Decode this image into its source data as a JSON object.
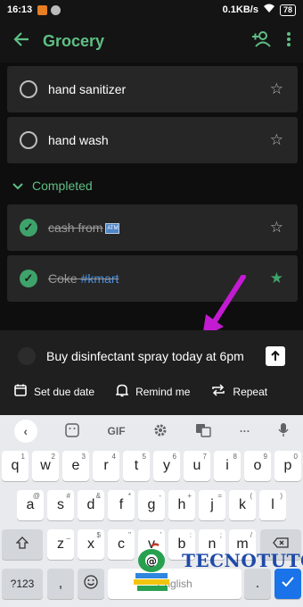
{
  "status_bar": {
    "time": "16:13",
    "speed": "0.1KB/s",
    "battery": "78"
  },
  "app_bar": {
    "title": "Grocery",
    "back_icon": "arrow-left",
    "share_icon": "person-add",
    "menu_icon": "more-vertical"
  },
  "tasks": [
    {
      "text": "hand sanitizer",
      "completed": false,
      "starred": false
    },
    {
      "text": "hand wash",
      "completed": false,
      "starred": false
    }
  ],
  "completed_section": {
    "label": "Completed",
    "items": [
      {
        "text": "cash from",
        "completed": true,
        "starred": false,
        "badge": "ATM"
      },
      {
        "text": "Coke",
        "tag": "#kmart",
        "completed": true,
        "starred": true
      }
    ]
  },
  "compose": {
    "input_value": "Buy disinfectant spray today at 6pm",
    "options": [
      "Set due date",
      "Remind me",
      "Repeat"
    ]
  },
  "keyboard": {
    "toolbar": [
      "GIF",
      "···"
    ],
    "row1": [
      "q",
      "w",
      "e",
      "r",
      "t",
      "y",
      "u",
      "i",
      "o",
      "p"
    ],
    "row1_hints": [
      "1",
      "2",
      "3",
      "4",
      "5",
      "6",
      "7",
      "8",
      "9",
      "0"
    ],
    "row2": [
      "a",
      "s",
      "d",
      "f",
      "g",
      "h",
      "j",
      "k",
      "l"
    ],
    "row2_hints": [
      "@",
      "#",
      "&",
      "*",
      "-",
      "+",
      "=",
      "(",
      ")"
    ],
    "row3": [
      "z",
      "x",
      "c",
      "v",
      "b",
      "n",
      "m"
    ],
    "row3_hints": [
      "_",
      "$",
      "\"",
      "'",
      ":",
      ";",
      "/"
    ],
    "symbols_key": "?123",
    "comma": ",",
    "space_label": "English",
    "period": "."
  },
  "watermark": {
    "text": "TECNOTUTO"
  },
  "colors": {
    "accent": "#5fbf84",
    "check_green": "#3ea36a",
    "tag_blue": "#4a90e2",
    "annotation_magenta": "#c21bd1"
  }
}
